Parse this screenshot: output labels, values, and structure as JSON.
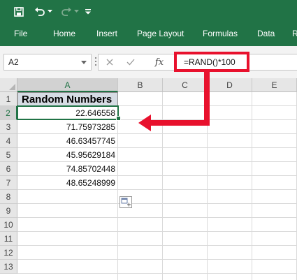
{
  "ribbon": {
    "tabs": [
      "File",
      "Home",
      "Insert",
      "Page Layout",
      "Formulas",
      "Data",
      "R"
    ]
  },
  "formula_bar": {
    "name_box": "A2",
    "fx_label": "fx",
    "formula": "=RAND()*100"
  },
  "sheet": {
    "columns": [
      "A",
      "B",
      "C",
      "D",
      "E"
    ],
    "rows": [
      "1",
      "2",
      "3",
      "4",
      "5",
      "6",
      "7",
      "8",
      "9",
      "10",
      "11",
      "12",
      "13"
    ],
    "header_cell": "Random Numbers",
    "values": [
      "22.646558",
      "71.75973285",
      "46.63457745",
      "45.95629184",
      "74.85702448",
      "48.65248999"
    ],
    "active_cell": "A2",
    "header_fill": "#d6dce4"
  },
  "annotation": {
    "color": "#e8112d"
  },
  "theme": {
    "accent": "#217346"
  }
}
